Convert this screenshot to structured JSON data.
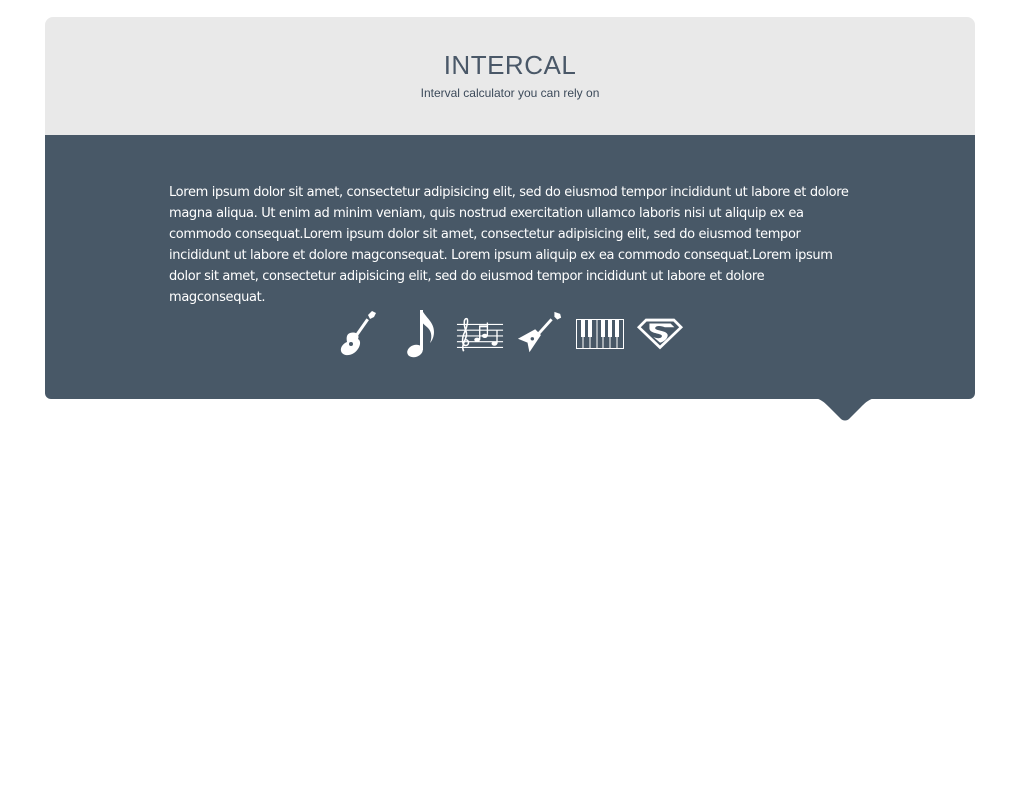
{
  "header": {
    "title": "INTERCAL",
    "subtitle": "Interval calculator you can rely on"
  },
  "main": {
    "description": "Lorem ipsum dolor sit amet, consectetur adipisicing elit, sed do eiusmod tempor incididunt ut labore et dolore magna aliqua. Ut enim ad minim veniam, quis nostrud exercitation ullamco laboris nisi ut aliquip ex ea commodo consequat.Lorem ipsum dolor sit amet, consectetur adipisicing elit, sed do eiusmod tempor incididunt ut labore et dolore magconsequat. Lorem ipsum aliquip ex ea commodo consequat.Lorem ipsum dolor sit amet, consectetur adipisicing elit, sed do eiusmod tempor incididunt ut labore et dolore magconsequat."
  },
  "icons": [
    {
      "name": "acoustic-guitar-icon"
    },
    {
      "name": "eighth-note-icon"
    },
    {
      "name": "sheet-music-icon"
    },
    {
      "name": "electric-guitar-icon"
    },
    {
      "name": "piano-keys-icon"
    },
    {
      "name": "superman-shield-icon"
    }
  ],
  "colors": {
    "header_bg": "#e9e9e9",
    "main_bg": "#485867",
    "title_text": "#4a5868",
    "icon": "#ffffff"
  }
}
